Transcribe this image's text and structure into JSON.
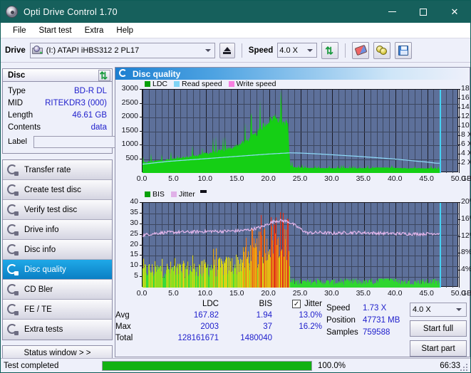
{
  "window": {
    "title": "Opti Drive Control 1.70",
    "minimize": "—",
    "maximize": "▢",
    "close": "✕"
  },
  "menu": [
    "File",
    "Start test",
    "Extra",
    "Help"
  ],
  "toolbar": {
    "drive_label": "Drive",
    "drive_value": "(I:)   ATAPI iHBS312   2 PL17",
    "speed_label": "Speed",
    "speed_value": "4.0 X",
    "icons": [
      "refresh-icon",
      "eraser-icon",
      "discs-icon",
      "save-icon"
    ]
  },
  "disc": {
    "title": "Disc",
    "rows": [
      {
        "key": "Type",
        "value": "BD-R DL"
      },
      {
        "key": "MID",
        "value": "RITEKDR3 (000)"
      },
      {
        "key": "Length",
        "value": "46.61 GB"
      },
      {
        "key": "Contents",
        "value": "data"
      }
    ],
    "label_key": "Label",
    "label_value": ""
  },
  "nav": {
    "items": [
      {
        "label": "Transfer rate",
        "selected": false
      },
      {
        "label": "Create test disc",
        "selected": false
      },
      {
        "label": "Verify test disc",
        "selected": false
      },
      {
        "label": "Drive info",
        "selected": false
      },
      {
        "label": "Disc info",
        "selected": false
      },
      {
        "label": "Disc quality",
        "selected": true
      },
      {
        "label": "CD Bler",
        "selected": false
      },
      {
        "label": "FE / TE",
        "selected": false
      },
      {
        "label": "Extra tests",
        "selected": false
      }
    ],
    "status_window": "Status window > >"
  },
  "panel": {
    "title": "Disc quality"
  },
  "stats": {
    "columns": [
      "",
      "LDC",
      "BIS",
      "Jitter"
    ],
    "jitter_checked": true,
    "rows": [
      {
        "label": "Avg",
        "ldc": "167.82",
        "bis": "1.94",
        "jitter": "13.0%"
      },
      {
        "label": "Max",
        "ldc": "2003",
        "bis": "37",
        "jitter": "16.2%"
      },
      {
        "label": "Total",
        "ldc": "128161671",
        "bis": "1480040",
        "jitter": ""
      }
    ]
  },
  "readout": {
    "speed_key": "Speed",
    "speed_value": "1.73 X",
    "position_key": "Position",
    "position_value": "47731 MB",
    "samples_key": "Samples",
    "samples_value": "759588",
    "speed_select": "4.0 X",
    "start_full": "Start full",
    "start_part": "Start part"
  },
  "statusbar": {
    "text": "Test completed",
    "percent_label": "100.0%",
    "percent_value": 100,
    "time": "66:33"
  },
  "chart_data": [
    {
      "type": "area",
      "id": "top-chart",
      "title": "Disc quality",
      "xlabel": "GB",
      "ylabel": "LDC",
      "y2label": "X",
      "xlim": [
        0,
        50
      ],
      "ylim": [
        0,
        3000
      ],
      "y2lim": [
        0,
        18
      ],
      "xticks": [
        "0.0",
        "5.0",
        "10.0",
        "15.0",
        "20.0",
        "25.0",
        "30.0",
        "35.0",
        "40.0",
        "45.0",
        "50.0"
      ],
      "yticks": [
        500,
        1000,
        1500,
        2000,
        2500,
        3000
      ],
      "y2ticks": [
        "2 X",
        "4 X",
        "6 X",
        "8 X",
        "10 X",
        "12 X",
        "14 X",
        "16 X",
        "18 X"
      ],
      "grid": true,
      "legend": [
        {
          "name": "LDC",
          "color": "#08a008"
        },
        {
          "name": "Read speed",
          "color": "#7fd4f5"
        },
        {
          "name": "Write speed",
          "color": "#f77fe0"
        }
      ],
      "series": [
        {
          "name": "LDC",
          "color": "#10c410",
          "x": [
            0,
            1,
            2,
            3,
            4,
            5,
            6,
            7,
            8,
            9,
            10,
            11,
            12,
            13,
            14,
            15,
            16,
            17,
            18,
            19,
            20,
            21,
            22,
            23,
            23.3,
            24,
            26,
            28,
            30,
            32,
            34,
            36,
            38,
            40,
            42,
            44,
            46,
            46.9
          ],
          "values": [
            350,
            400,
            420,
            450,
            470,
            500,
            520,
            560,
            600,
            640,
            690,
            720,
            760,
            820,
            880,
            980,
            1080,
            1220,
            1380,
            1650,
            1850,
            2000,
            1800,
            1750,
            260,
            200,
            180,
            170,
            170,
            165,
            165,
            170,
            200,
            175,
            170,
            165,
            160,
            150
          ]
        },
        {
          "name": "Read speed",
          "color": "#7fd4f5",
          "x": [
            0,
            2,
            4,
            6,
            8,
            10,
            12,
            14,
            16,
            18,
            20,
            22,
            23.3,
            25,
            28,
            31,
            34,
            37,
            40,
            43,
            45,
            46.5,
            47,
            47
          ],
          "values": [
            1.9,
            2.2,
            2.5,
            2.7,
            2.9,
            3.1,
            3.3,
            3.5,
            3.7,
            3.9,
            4.1,
            4.25,
            4.35,
            4.3,
            4.1,
            3.85,
            3.6,
            3.3,
            3.0,
            2.6,
            2.35,
            2.1,
            2.1,
            18
          ]
        }
      ],
      "marker_line": {
        "x": 47,
        "color": "#45d2f2"
      }
    },
    {
      "type": "area",
      "id": "bottom-chart",
      "xlabel": "GB",
      "ylabel": "BIS",
      "y2label": "%",
      "xlim": [
        0,
        50
      ],
      "ylim": [
        0,
        40
      ],
      "y2lim": [
        0,
        20
      ],
      "xticks": [
        "0.0",
        "5.0",
        "10.0",
        "15.0",
        "20.0",
        "25.0",
        "30.0",
        "35.0",
        "40.0",
        "45.0",
        "50.0"
      ],
      "yticks": [
        5,
        10,
        15,
        20,
        25,
        30,
        35,
        40
      ],
      "y2ticks": [
        "4%",
        "8%",
        "12%",
        "16%",
        "20%"
      ],
      "grid": true,
      "legend": [
        {
          "name": "BIS",
          "color": "#08a008"
        },
        {
          "name": "Jitter",
          "color": "#e0b0e8"
        }
      ],
      "series": [
        {
          "name": "BIS",
          "color": "#2fd62f",
          "x": [
            0,
            1,
            2,
            3,
            4,
            5,
            6,
            7,
            8,
            9,
            10,
            11,
            12,
            13,
            14,
            15,
            16,
            17,
            18,
            19,
            20,
            21,
            22,
            23,
            23.3,
            25,
            27,
            29,
            31,
            33,
            35,
            37,
            38.5,
            40,
            42,
            44,
            46,
            46.9
          ],
          "values": [
            9,
            9.5,
            9,
            10,
            9.5,
            10,
            9.5,
            10,
            10,
            10,
            10.5,
            11,
            11,
            11.5,
            12,
            13,
            15,
            17,
            19,
            23,
            26,
            30,
            28,
            27,
            3,
            3,
            3,
            3,
            3,
            3,
            3,
            3,
            9,
            3,
            3,
            3,
            3.2,
            3
          ]
        },
        {
          "name": "Jitter",
          "color": "#e8b6ee",
          "x": [
            0,
            1,
            2,
            3,
            4,
            5,
            6,
            7,
            8,
            9,
            10,
            11,
            12,
            13,
            14,
            15,
            16,
            17,
            18,
            19,
            20,
            21,
            22,
            23,
            24,
            26,
            28,
            30,
            32,
            34,
            36,
            38,
            40,
            42,
            44,
            46,
            46.9
          ],
          "values": [
            24.7,
            25.2,
            25.6,
            25.9,
            26.0,
            26.1,
            26.2,
            26.2,
            26.3,
            26.4,
            26.5,
            26.6,
            26.5,
            26.6,
            26.7,
            26.8,
            27.0,
            27.4,
            28.0,
            28.8,
            30.3,
            31.5,
            31.6,
            31.2,
            29.5,
            25.8,
            26.0,
            25.6,
            25.9,
            26.0,
            25.8,
            25.6,
            25.5,
            25.4,
            25.3,
            25.6,
            25.5
          ]
        }
      ],
      "marker_line": {
        "x": 47,
        "color": "#45d2f2"
      }
    }
  ]
}
